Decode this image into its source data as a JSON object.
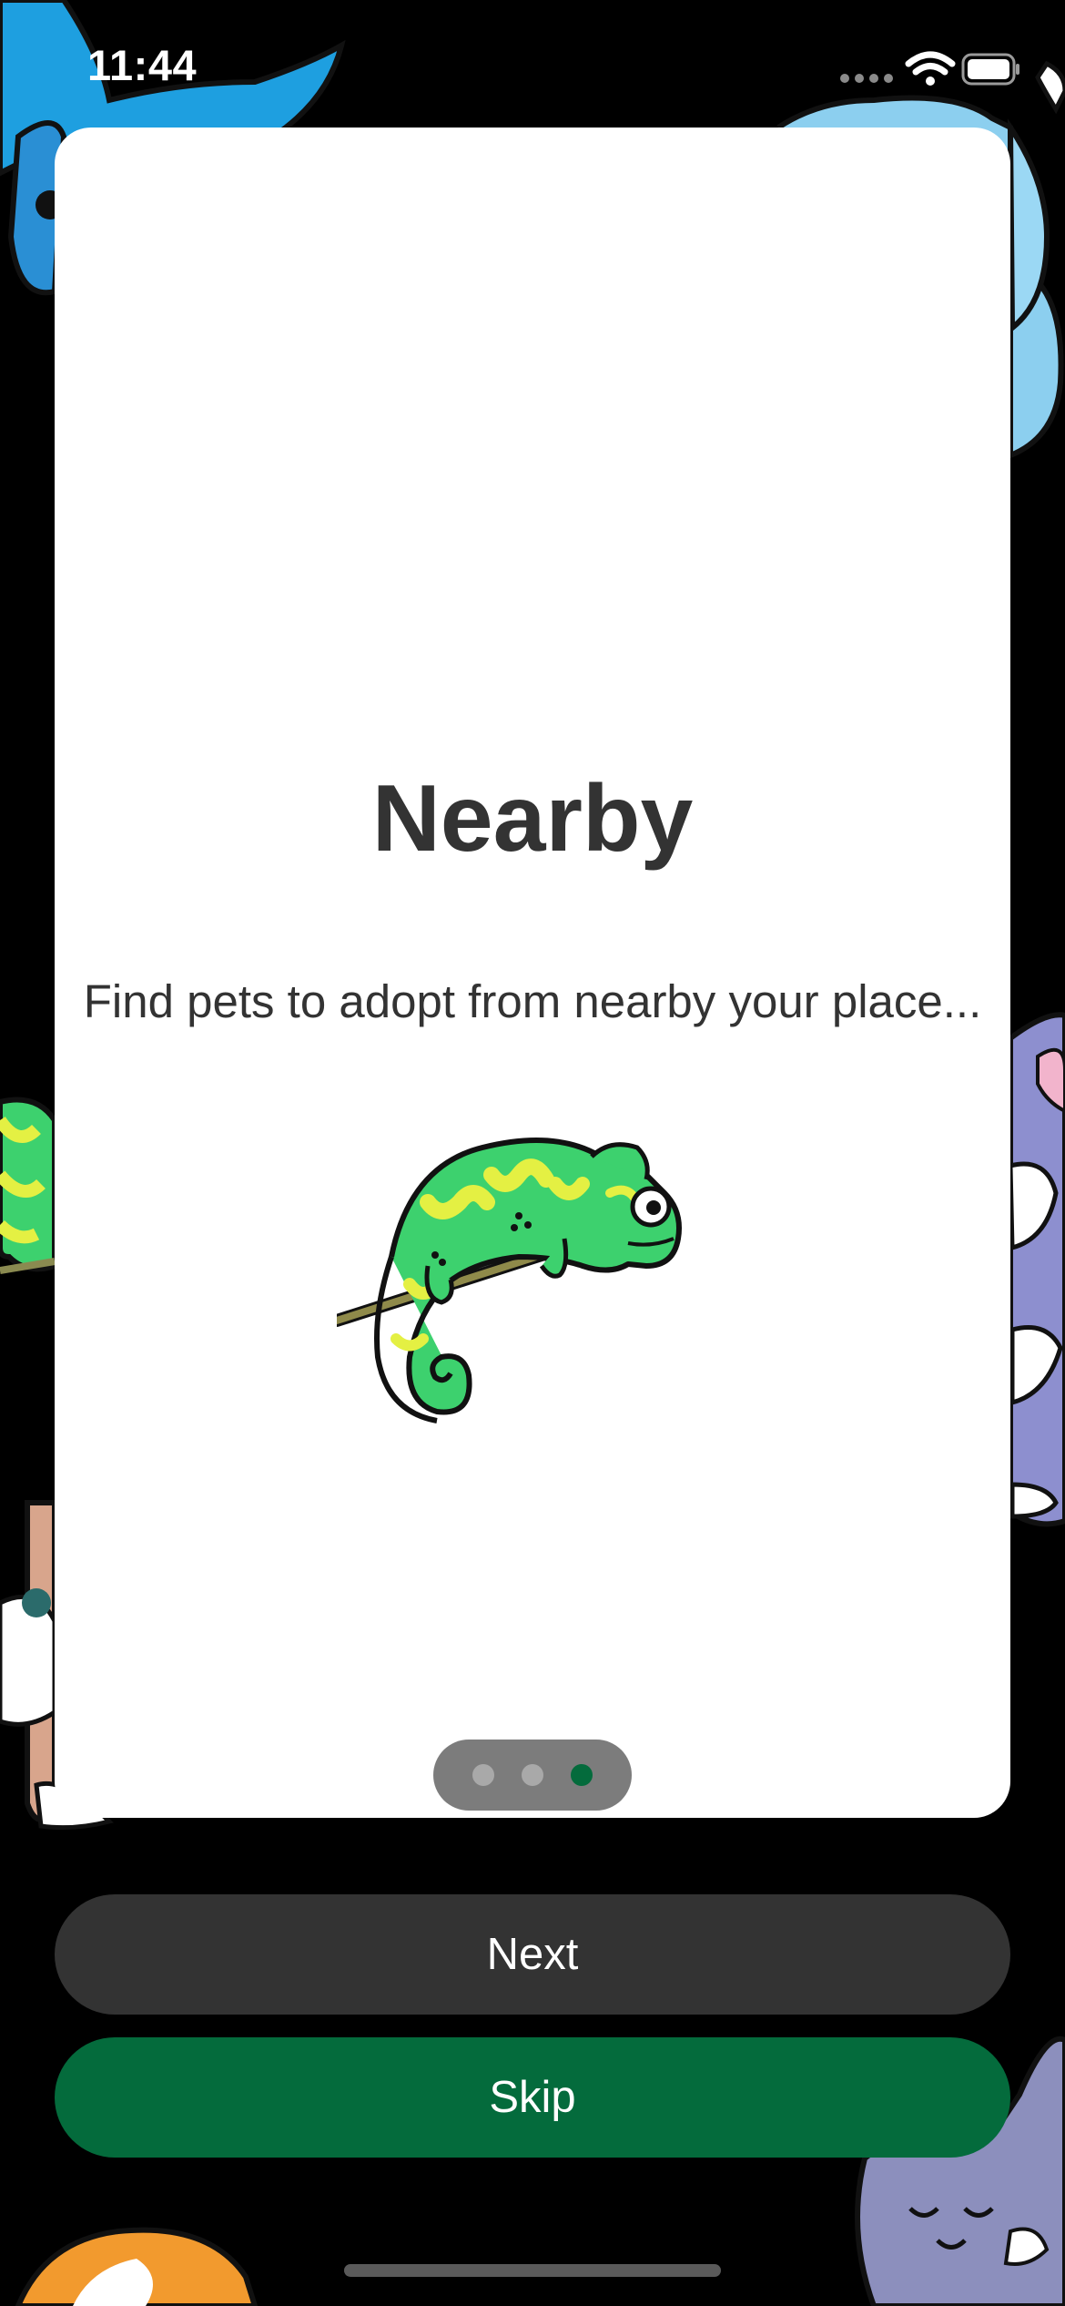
{
  "status_bar": {
    "time": "11:44"
  },
  "onboarding": {
    "title": "Nearby",
    "subtitle": "Find pets to adopt from nearby your place...",
    "illustration": "chameleon-illustration",
    "pages_total": 3,
    "current_page": 3
  },
  "actions": {
    "next_label": "Next",
    "skip_label": "Skip"
  },
  "colors": {
    "background": "#000000",
    "card": "#ffffff",
    "title_text": "#333333",
    "next_button": "#333333",
    "skip_button": "#046b3c",
    "active_dot": "#046b3c",
    "inactive_dot": "#a9a9a9"
  },
  "icons": [
    "cellular-signal-icon",
    "wifi-icon",
    "battery-icon"
  ]
}
